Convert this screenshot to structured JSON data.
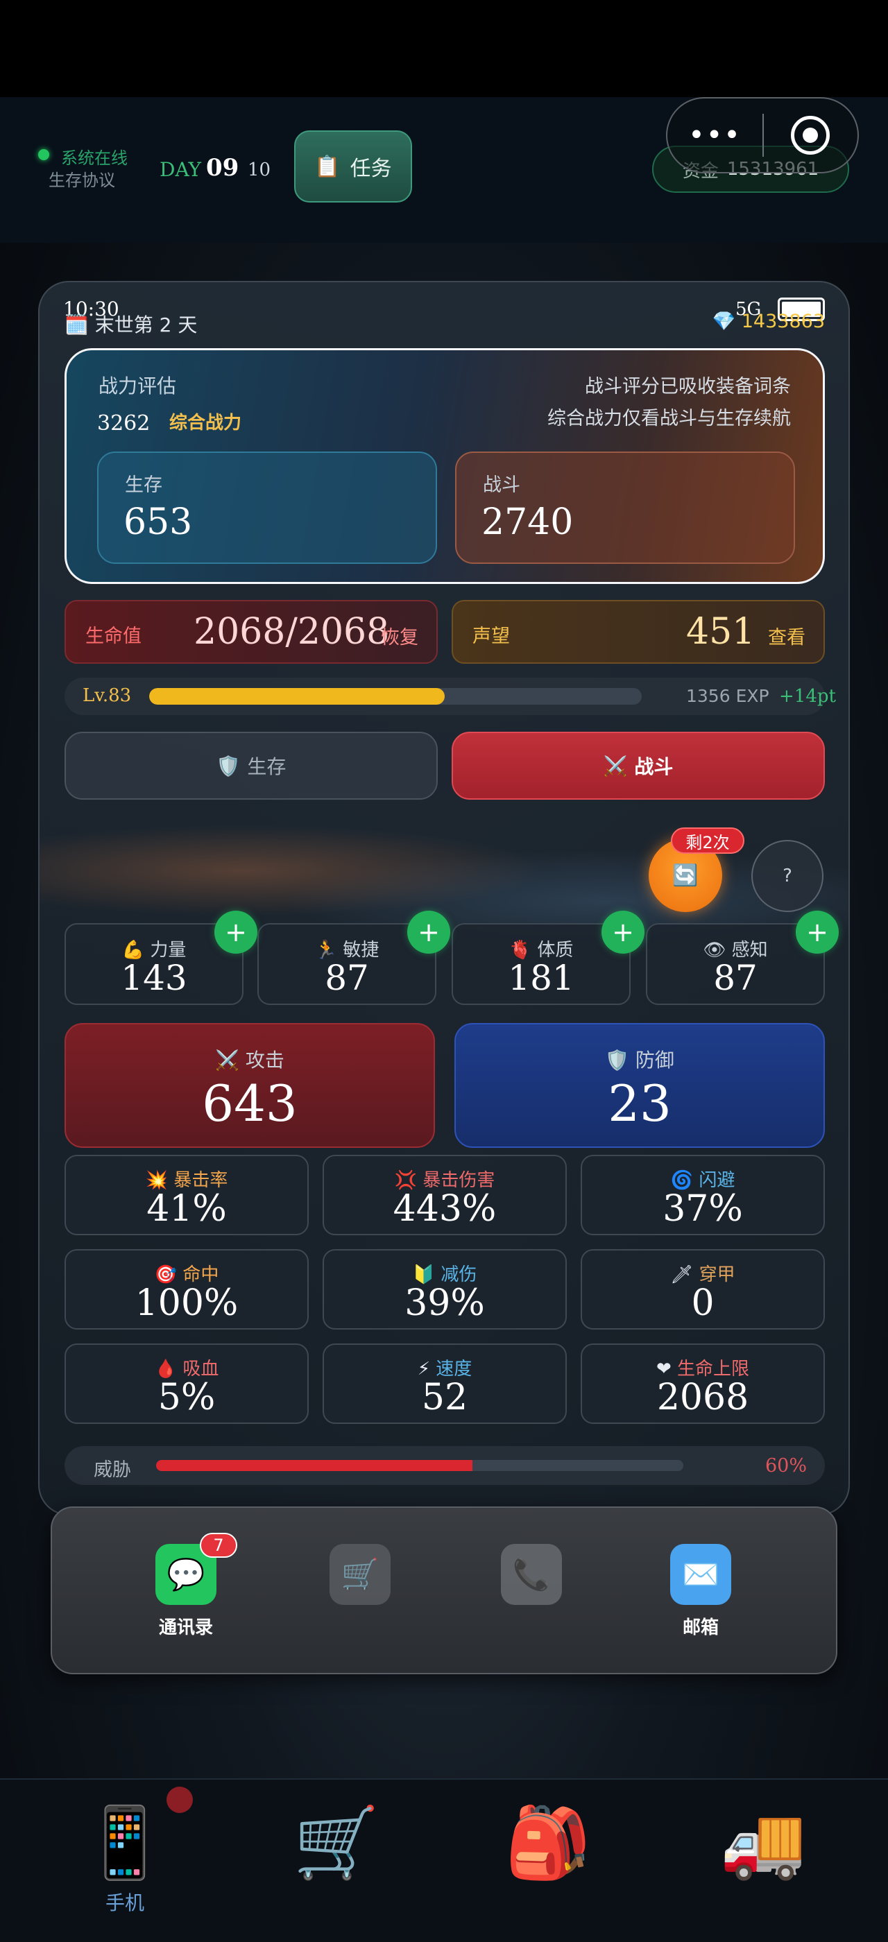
{
  "topbar": {
    "status_online": "系统在线",
    "status_protocol": "生存协议",
    "day_label": "DAY",
    "day_number": "09",
    "day_sub": "10",
    "task_button": "任务",
    "fund_label": "资金",
    "fund_value": "15313961",
    "capsule_dots": "•••"
  },
  "phone": {
    "time": "10:30",
    "network": "5G",
    "end_day": "末世第 2 天",
    "gems": "1433863"
  },
  "power": {
    "title": "战力评估",
    "score": "3262",
    "score_label": "综合战力",
    "note_line1": "战斗评分已吸收装备词条",
    "note_line2": "综合战力仅看战斗与生存续航",
    "survive_label": "生存",
    "survive_value": "653",
    "battle_label": "战斗",
    "battle_value": "2740"
  },
  "hp": {
    "label": "生命值",
    "value": "2068/2068",
    "action": "恢复"
  },
  "reputation": {
    "label": "声望",
    "value": "451",
    "action": "查看"
  },
  "level": {
    "label": "Lv.83",
    "progress": 0.6,
    "exp": "1356 EXP",
    "points": "+14pt"
  },
  "modes": {
    "survive": "生存",
    "battle": "战斗"
  },
  "refresh": {
    "remaining": "剩2次",
    "help": "?"
  },
  "attributes": [
    {
      "label": "力量",
      "value": "143",
      "icon": "💪"
    },
    {
      "label": "敏捷",
      "value": "87",
      "icon": "🏃"
    },
    {
      "label": "体质",
      "value": "181",
      "icon": "🫀"
    },
    {
      "label": "感知",
      "value": "87",
      "icon": "👁"
    }
  ],
  "attack": {
    "label": "攻击",
    "value": "643"
  },
  "defense": {
    "label": "防御",
    "value": "23"
  },
  "stats": [
    {
      "label": "暴击率",
      "value": "41%",
      "color": "#f4a64d",
      "icon": "💥"
    },
    {
      "label": "暴击伤害",
      "value": "443%",
      "color": "#ef6b6b",
      "icon": "💢"
    },
    {
      "label": "闪避",
      "value": "37%",
      "color": "#5ab3e6",
      "icon": "🌀"
    },
    {
      "label": "命中",
      "value": "100%",
      "color": "#f4a64d",
      "icon": "🎯"
    },
    {
      "label": "减伤",
      "value": "39%",
      "color": "#5ab3e6",
      "icon": "🔰"
    },
    {
      "label": "穿甲",
      "value": "0",
      "color": "#e0a25b",
      "icon": "🗡"
    },
    {
      "label": "吸血",
      "value": "5%",
      "color": "#ef6b6b",
      "icon": "🩸"
    },
    {
      "label": "速度",
      "value": "52",
      "color": "#5ab3e6",
      "icon": "⚡"
    },
    {
      "label": "生命上限",
      "value": "2068",
      "color": "#ef6b6b",
      "icon": "❤"
    }
  ],
  "threat": {
    "label": "威胁",
    "value": "60%",
    "progress": 0.6
  },
  "dock": {
    "contacts_label": "通讯录",
    "contacts_badge": "7",
    "mail_label": "邮箱"
  },
  "tabbar": {
    "phone_label": "手机"
  },
  "colors": {
    "accent_green": "#22b35a",
    "danger_red": "#d9262f",
    "gold": "#f4c04d"
  }
}
